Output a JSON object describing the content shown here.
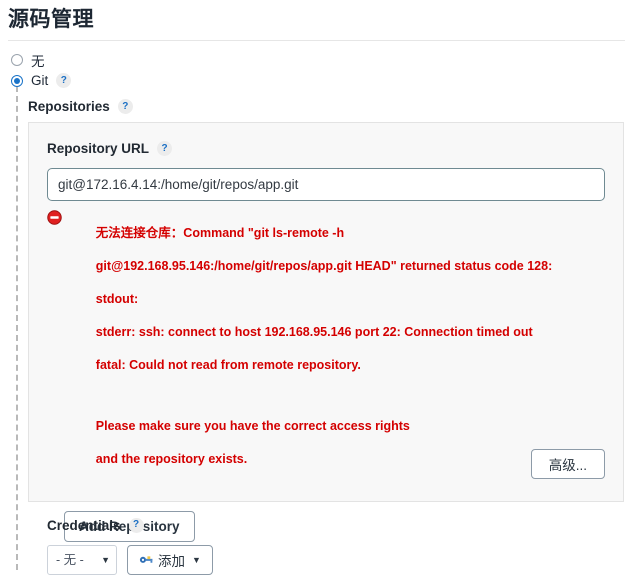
{
  "page": {
    "title": "源码管理"
  },
  "scm_options": [
    {
      "label": "无",
      "selected": false,
      "has_help": false
    },
    {
      "label": "Git",
      "selected": true,
      "has_help": true
    }
  ],
  "repositories": {
    "heading": "Repositories",
    "help": "?",
    "repository_url": {
      "label": "Repository URL",
      "help": "?",
      "value": "git@172.16.4.14:/home/git/repos/app.git",
      "placeholder": ""
    },
    "error": {
      "icon": "error-circle-icon",
      "line1": "无法连接仓库：Command \"git ls-remote -h",
      "line2": "git@192.168.95.146:/home/git/repos/app.git HEAD\" returned status code 128:",
      "line3": "stdout:",
      "line4": "stderr: ssh: connect to host 192.168.95.146 port 22: Connection timed out",
      "line5": "fatal: Could not read from remote repository.",
      "line6": "Please make sure you have the correct access rights",
      "line7": "and the repository exists.",
      "color": "#d40000"
    },
    "credentials": {
      "label": "Credentials",
      "help": "?",
      "selected": "- 无 -",
      "options": [
        "- 无 -"
      ],
      "add_button": {
        "label": "添加",
        "icon": "key-icon",
        "caret": "▼"
      }
    },
    "advanced_button": {
      "label": "高级..."
    }
  },
  "add_repository_button": {
    "label": "Add Repository"
  },
  "colors": {
    "accent": "#1a73c8",
    "error": "#d40000",
    "panel_bg": "#f8f8f8",
    "panel_border": "#e3e3e3",
    "input_border": "#6f8a92"
  }
}
